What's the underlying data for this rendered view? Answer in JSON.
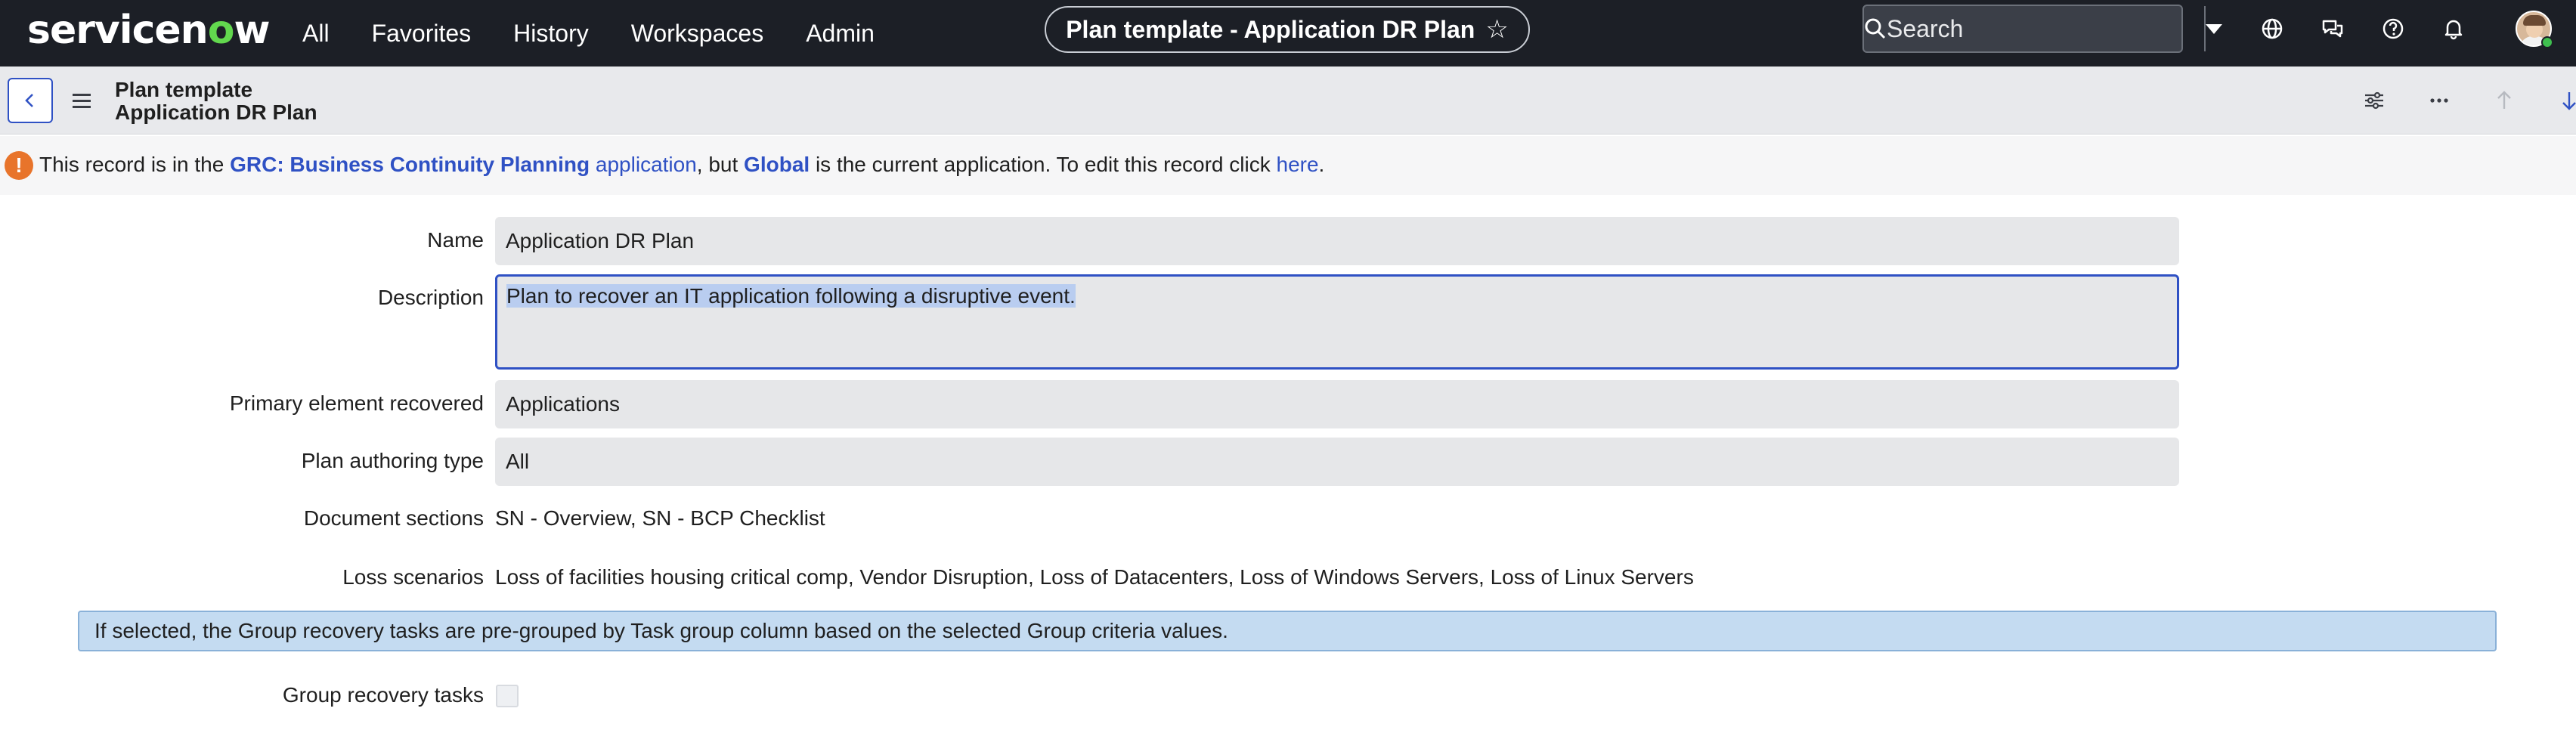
{
  "nav": {
    "logo_main": "servicen",
    "logo_accent": "o",
    "logo_end": "w",
    "links": [
      "All",
      "Favorites",
      "History",
      "Workspaces",
      "Admin"
    ],
    "context_title": "Plan template - Application DR Plan",
    "search_placeholder": "Search"
  },
  "record": {
    "table": "Plan template",
    "name": "Application DR Plan"
  },
  "info": {
    "t1": "This record is in the ",
    "scope_link": "GRC: Business Continuity Planning",
    "t2": " application",
    "t3": ", but ",
    "global_link": "Global",
    "t4": " is the current application. To edit this record click ",
    "here_link": "here",
    "t5": "."
  },
  "form": {
    "name_label": "Name",
    "name_value": "Application DR Plan",
    "description_label": "Description",
    "description_value": "Plan to recover an IT application following a disruptive event.",
    "primary_label": "Primary element recovered",
    "primary_value": "Applications",
    "authoring_label": "Plan authoring type",
    "authoring_value": "All",
    "sections_label": "Document sections",
    "sections_value": "SN - Overview, SN - BCP Checklist",
    "loss_label": "Loss scenarios",
    "loss_value": "Loss of facilities housing critical comp, Vendor Disruption, Loss of Datacenters, Loss of Windows Servers, Loss of Linux Servers",
    "hint": "If selected, the Group recovery tasks are pre-grouped by Task group column based on the selected Group criteria values.",
    "group_label": "Group recovery tasks",
    "group_checked": false
  },
  "colors": {
    "nav_bg": "#1c1f26",
    "accent": "#2f51c4",
    "logo_accent": "#62d84e",
    "warning": "#e8742b",
    "hint_bg": "#c4dbf1"
  },
  "icons": {
    "top": [
      "globe-icon",
      "chat-icon",
      "help-icon",
      "bell-icon"
    ],
    "record_header": [
      "settings-sliders-icon",
      "more-icon",
      "arrow-up-icon",
      "arrow-down-icon"
    ]
  }
}
